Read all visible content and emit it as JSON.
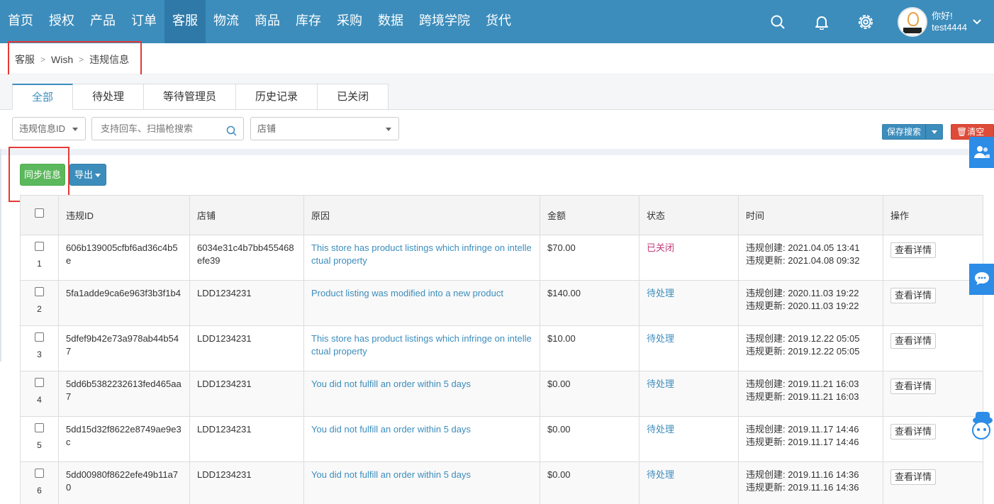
{
  "nav": {
    "items": [
      {
        "label": "首页",
        "active": false
      },
      {
        "label": "授权",
        "active": false
      },
      {
        "label": "产品",
        "active": false
      },
      {
        "label": "订单",
        "active": false
      },
      {
        "label": "客服",
        "active": true
      },
      {
        "label": "物流",
        "active": false
      },
      {
        "label": "商品",
        "active": false
      },
      {
        "label": "库存",
        "active": false
      },
      {
        "label": "采购",
        "active": false
      },
      {
        "label": "数据",
        "active": false
      },
      {
        "label": "跨境学院",
        "active": false
      },
      {
        "label": "货代",
        "active": false
      }
    ],
    "greeting": "你好!",
    "username": "test4444"
  },
  "breadcrumb": [
    "客服",
    "Wish",
    "违规信息"
  ],
  "tabs": [
    {
      "label": "全部",
      "active": true
    },
    {
      "label": "待处理",
      "active": false
    },
    {
      "label": "等待管理员",
      "active": false
    },
    {
      "label": "历史记录",
      "active": false
    },
    {
      "label": "已关闭",
      "active": false
    }
  ],
  "search": {
    "field_select": "违规信息ID",
    "input_placeholder": "支持回车、扫描枪搜索",
    "store_select": "店铺",
    "save_label": "保存搜索",
    "clear_label": "清空"
  },
  "actions": {
    "sync_label": "同步信息",
    "export_label": "导出"
  },
  "table": {
    "headers": [
      "违规ID",
      "店铺",
      "原因",
      "金额",
      "状态",
      "时间",
      "操作"
    ],
    "rows": [
      {
        "num": "1",
        "id": "606b139005cfbf6ad36c4b5e",
        "store": "6034e31c4b7bb455468efe39",
        "reason": "This store has product listings which infringe on intellectual property",
        "amount": "$70.00",
        "status": "已关闭",
        "status_type": "closed",
        "created": "违规创建: 2021.04.05 13:41",
        "updated": "违规更新: 2021.04.08 09:32",
        "action": "查看详情"
      },
      {
        "num": "2",
        "id": "5fa1adde9ca6e963f3b3f1b4",
        "store": "LDD1234231",
        "reason": "Product listing was modified into a new product",
        "amount": "$140.00",
        "status": "待处理",
        "status_type": "pending",
        "created": "违规创建: 2020.11.03 19:22",
        "updated": "违规更新: 2020.11.03 19:22",
        "action": "查看详情"
      },
      {
        "num": "3",
        "id": "5dfef9b42e73a978ab44b547",
        "store": "LDD1234231",
        "reason": "This store has product listings which infringe on intellectual property",
        "amount": "$10.00",
        "status": "待处理",
        "status_type": "pending",
        "created": "违规创建: 2019.12.22 05:05",
        "updated": "违规更新: 2019.12.22 05:05",
        "action": "查看详情"
      },
      {
        "num": "4",
        "id": "5dd6b5382232613fed465aa7",
        "store": "LDD1234231",
        "reason": "You did not fulfill an order within 5 days",
        "amount": "$0.00",
        "status": "待处理",
        "status_type": "pending",
        "created": "违规创建: 2019.11.21 16:03",
        "updated": "违规更新: 2019.11.21 16:03",
        "action": "查看详情"
      },
      {
        "num": "5",
        "id": "5dd15d32f8622e8749ae9e3c",
        "store": "LDD1234231",
        "reason": "You did not fulfill an order within 5 days",
        "amount": "$0.00",
        "status": "待处理",
        "status_type": "pending",
        "created": "违规创建: 2019.11.17 14:46",
        "updated": "违规更新: 2019.11.17 14:46",
        "action": "查看详情"
      },
      {
        "num": "6",
        "id": "5dd00980f8622efe49b11a70",
        "store": "LDD1234231",
        "reason": "You did not fulfill an order within 5 days",
        "amount": "$0.00",
        "status": "待处理",
        "status_type": "pending",
        "created": "违规创建: 2019.11.16 14:36",
        "updated": "违规更新: 2019.11.16 14:36",
        "action": "查看详情"
      }
    ]
  },
  "icons": {
    "search": "search-icon",
    "bell": "bell-icon",
    "settings": "gear-icon",
    "contacts": "contacts-icon",
    "chat": "chat-icon",
    "robot": "robot-icon"
  },
  "colors": {
    "primary": "#3c8dbc",
    "success": "#5cb85c",
    "danger": "#dd4b39",
    "closed_status": "#c0397a",
    "highlight": "#e53935"
  }
}
